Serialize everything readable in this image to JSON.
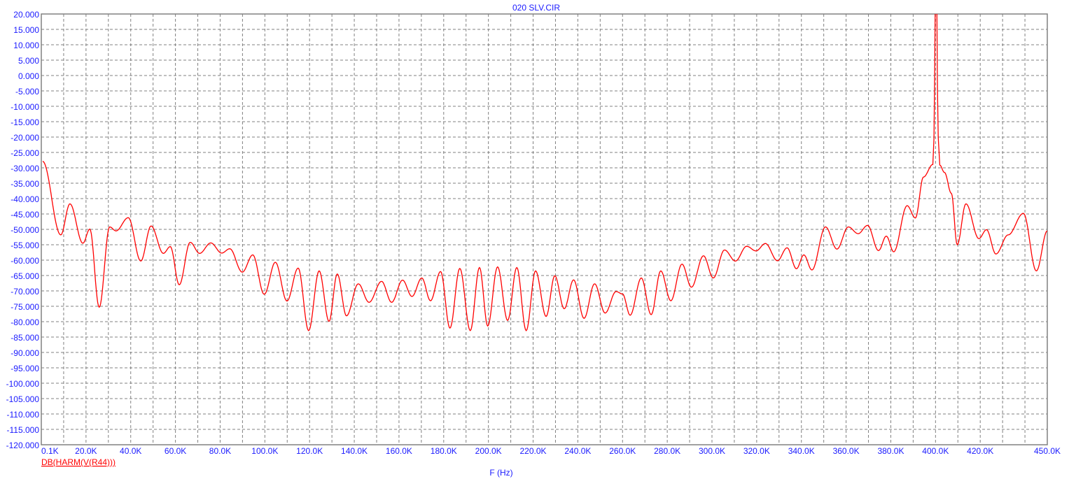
{
  "chart_data": {
    "type": "line",
    "title": "020 SLV.CIR",
    "xlabel": "F (Hz)",
    "ylabel": "",
    "xlim": [
      0.1,
      450
    ],
    "ylim": [
      -120,
      20
    ],
    "grid": true,
    "x_tick_labels": [
      {
        "value": 0.1,
        "label": "0.1K"
      },
      {
        "value": 20,
        "label": "20.0K"
      },
      {
        "value": 40,
        "label": "40.0K"
      },
      {
        "value": 60,
        "label": "60.0K"
      },
      {
        "value": 80,
        "label": "80.0K"
      },
      {
        "value": 100,
        "label": "100.0K"
      },
      {
        "value": 120,
        "label": "120.0K"
      },
      {
        "value": 140,
        "label": "140.0K"
      },
      {
        "value": 160,
        "label": "160.0K"
      },
      {
        "value": 180,
        "label": "180.0K"
      },
      {
        "value": 200,
        "label": "200.0K"
      },
      {
        "value": 220,
        "label": "220.0K"
      },
      {
        "value": 240,
        "label": "240.0K"
      },
      {
        "value": 260,
        "label": "260.0K"
      },
      {
        "value": 280,
        "label": "280.0K"
      },
      {
        "value": 300,
        "label": "300.0K"
      },
      {
        "value": 320,
        "label": "320.0K"
      },
      {
        "value": 340,
        "label": "340.0K"
      },
      {
        "value": 360,
        "label": "360.0K"
      },
      {
        "value": 380,
        "label": "380.0K"
      },
      {
        "value": 400,
        "label": "400.0K"
      },
      {
        "value": 420,
        "label": "420.0K"
      },
      {
        "value": 450,
        "label": "450.0K"
      }
    ],
    "y_tick_labels": [
      "20.000",
      "15.000",
      "10.000",
      "5.000",
      "0.000",
      "-5.000",
      "-10.000",
      "-15.000",
      "-20.000",
      "-25.000",
      "-30.000",
      "-35.000",
      "-40.000",
      "-45.000",
      "-50.000",
      "-55.000",
      "-60.000",
      "-65.000",
      "-70.000",
      "-75.000",
      "-80.000",
      "-85.000",
      "-90.000",
      "-95.000",
      "-100.000",
      "-105.000",
      "-110.000",
      "-115.000",
      "-120.000"
    ],
    "x_unit": "kHz",
    "series": [
      {
        "name": "DB(HARM(V(R44)))",
        "color": "#ff0000",
        "points": [
          [
            0.6,
            -27.9
          ],
          [
            8.7,
            -51.8
          ],
          [
            12.8,
            -41.7
          ],
          [
            18.6,
            -54.5
          ],
          [
            21.7,
            -49.9
          ],
          [
            25.9,
            -75.3
          ],
          [
            30.6,
            -49.2
          ],
          [
            33.4,
            -50.5
          ],
          [
            38.9,
            -46.2
          ],
          [
            44.5,
            -60.3
          ],
          [
            49.1,
            -48.9
          ],
          [
            54.6,
            -57.8
          ],
          [
            57.7,
            -55.6
          ],
          [
            61.7,
            -68.0
          ],
          [
            66.6,
            -54.2
          ],
          [
            70.8,
            -57.8
          ],
          [
            75.8,
            -54.4
          ],
          [
            80.7,
            -57.7
          ],
          [
            84.3,
            -56.3
          ],
          [
            89.9,
            -63.9
          ],
          [
            94.6,
            -58.3
          ],
          [
            99.7,
            -71.1
          ],
          [
            104.7,
            -60.7
          ],
          [
            109.9,
            -73.3
          ],
          [
            114.9,
            -62.6
          ],
          [
            119.6,
            -82.9
          ],
          [
            124.3,
            -63.5
          ],
          [
            128.7,
            -79.9
          ],
          [
            132.4,
            -64.5
          ],
          [
            136.5,
            -78.1
          ],
          [
            141.8,
            -67.7
          ],
          [
            146.6,
            -73.7
          ],
          [
            152.2,
            -66.9
          ],
          [
            156.7,
            -73.7
          ],
          [
            161.6,
            -66.5
          ],
          [
            165.8,
            -71.8
          ],
          [
            170.2,
            -65.8
          ],
          [
            174.1,
            -73.2
          ],
          [
            178.6,
            -63.7
          ],
          [
            182.8,
            -82.1
          ],
          [
            187.2,
            -62.7
          ],
          [
            191.9,
            -82.9
          ],
          [
            196.0,
            -62.4
          ],
          [
            199.7,
            -81.4
          ],
          [
            204.1,
            -62.2
          ],
          [
            208.6,
            -79.6
          ],
          [
            212.7,
            -62.4
          ],
          [
            216.9,
            -82.9
          ],
          [
            221.1,
            -63.5
          ],
          [
            225.8,
            -78.3
          ],
          [
            229.7,
            -65.1
          ],
          [
            233.9,
            -75.8
          ],
          [
            238.1,
            -66.4
          ],
          [
            242.8,
            -78.9
          ],
          [
            247.5,
            -67.7
          ],
          [
            252.2,
            -77.2
          ],
          [
            257.1,
            -70.2
          ],
          [
            260.0,
            -71.0
          ],
          [
            263.4,
            -77.9
          ],
          [
            268.4,
            -65.8
          ],
          [
            272.8,
            -77.7
          ],
          [
            277.1,
            -63.5
          ],
          [
            281.6,
            -73.2
          ],
          [
            286.6,
            -61.3
          ],
          [
            290.8,
            -68.8
          ],
          [
            296.2,
            -58.6
          ],
          [
            300.6,
            -65.8
          ],
          [
            305.6,
            -56.7
          ],
          [
            310.5,
            -60.3
          ],
          [
            315.5,
            -55.5
          ],
          [
            319.7,
            -57.0
          ],
          [
            323.9,
            -54.6
          ],
          [
            329.3,
            -60.2
          ],
          [
            333.6,
            -56.0
          ],
          [
            337.8,
            -62.8
          ],
          [
            341.1,
            -58.3
          ],
          [
            344.7,
            -63.2
          ],
          [
            350.8,
            -49.2
          ],
          [
            355.9,
            -56.4
          ],
          [
            361.0,
            -49.2
          ],
          [
            365.4,
            -51.4
          ],
          [
            369.6,
            -48.7
          ],
          [
            374.5,
            -56.9
          ],
          [
            378.0,
            -52.2
          ],
          [
            381.3,
            -57.3
          ],
          [
            387.3,
            -42.3
          ],
          [
            391.0,
            -46.3
          ],
          [
            394.6,
            -33.0
          ],
          [
            398.8,
            -28.9
          ],
          [
            399.3,
            -20.5
          ],
          [
            399.6,
            0
          ],
          [
            400.0,
            35
          ],
          [
            400.5,
            35
          ],
          [
            400.8,
            0
          ],
          [
            401.2,
            -20
          ],
          [
            401.9,
            -29.1
          ],
          [
            404.0,
            -31.5
          ],
          [
            407.1,
            -38.3
          ],
          [
            409.7,
            -55.0
          ],
          [
            413.6,
            -41.7
          ],
          [
            419.4,
            -53.0
          ],
          [
            422.8,
            -50.1
          ],
          [
            427.0,
            -58.0
          ],
          [
            432.5,
            -51.8
          ],
          [
            439.3,
            -44.8
          ],
          [
            445.1,
            -63.5
          ],
          [
            450.0,
            -50.5
          ]
        ]
      }
    ]
  },
  "colors": {
    "axis_text": "#1a1aff",
    "grid": "#808080",
    "trace": "#ff0000"
  }
}
